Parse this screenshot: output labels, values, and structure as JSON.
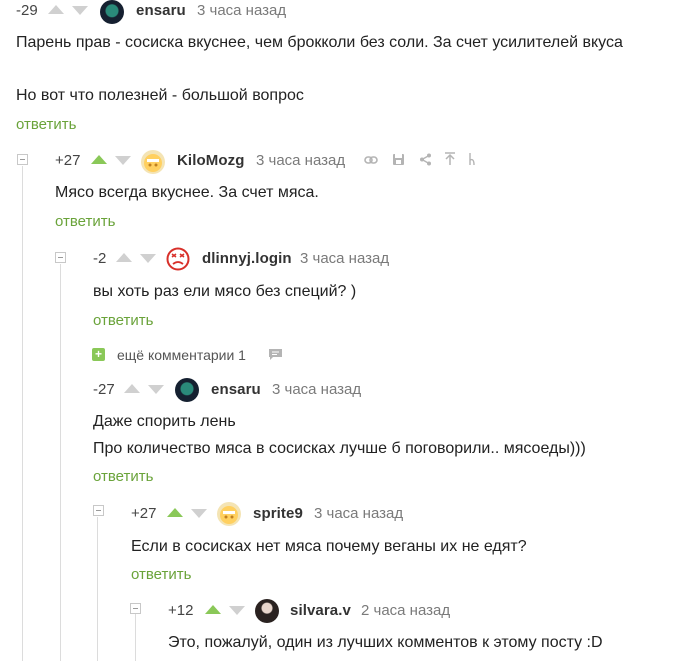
{
  "comments": [
    {
      "rating": "-29",
      "user": "ensaru",
      "time": "3 часа назад",
      "lines": [
        "Парень прав - сосиска вкуснее, чем брокколи без соли. За счет усилителей вкуса",
        "",
        "Но вот что полезней - большой вопрос"
      ],
      "reply": "ответить"
    },
    {
      "rating": "+27",
      "user": "KiloMozg",
      "time": "3 часа назад",
      "lines": [
        "Мясо всегда вкуснее. За счет мяса."
      ],
      "reply": "ответить"
    },
    {
      "rating": "-2",
      "user": "dlinnyj.login",
      "time": "3 часа назад",
      "lines": [
        "вы хоть раз ели мясо без специй? )"
      ],
      "reply": "ответить"
    },
    {
      "rating": "-27",
      "user": "ensaru",
      "time": "3 часа назад",
      "lines": [
        "Даже спорить лень",
        "Про количество мяса в сосисках лучше б поговорили.. мясоеды)))"
      ],
      "reply": "ответить"
    },
    {
      "rating": "+27",
      "user": "sprite9",
      "time": "3 часа назад",
      "lines": [
        "Если в сосисках нет мяса почему веганы их не едят?"
      ],
      "reply": "ответить"
    },
    {
      "rating": "+12",
      "user": "silvara.v",
      "time": "2 часа назад",
      "lines": [
        "Это, пожалуй, один из лучших комментов к этому посту :D"
      ]
    }
  ],
  "more_comments": {
    "label": "ещё комментарии 1"
  },
  "colors": {
    "accent": "#8ac858",
    "reply": "#6aa33a"
  },
  "icons": [
    "arrow-up-icon",
    "arrow-down-icon",
    "link-icon",
    "save-icon",
    "share-icon",
    "go-to-parent-icon",
    "go-to-root-icon",
    "comment-bubble-icon"
  ]
}
